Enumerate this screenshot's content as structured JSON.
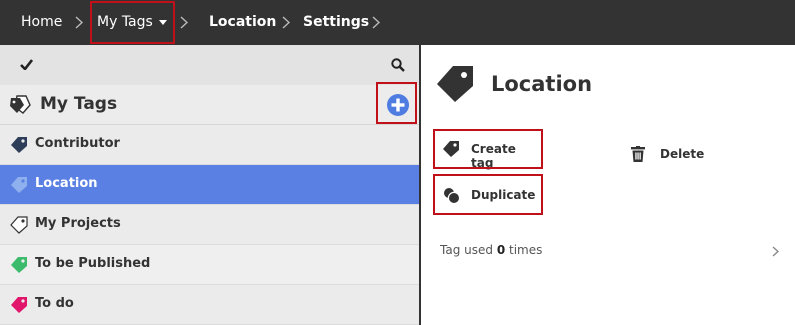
{
  "breadcrumb": {
    "items": [
      {
        "label": "Home"
      },
      {
        "label": "My Tags"
      },
      {
        "label": "Location"
      },
      {
        "label": "Settings"
      }
    ]
  },
  "sidebar": {
    "title": "My Tags",
    "tags": [
      {
        "label": "Contributor",
        "color": "#2e3e58"
      },
      {
        "label": "Location",
        "color": "#6f9ae6",
        "active": true
      },
      {
        "label": "My Projects",
        "color": "#ffffff"
      },
      {
        "label": "To be Published",
        "color": "#3dbb6c"
      },
      {
        "label": "To do",
        "color": "#e0156b"
      }
    ]
  },
  "detail": {
    "title": "Location",
    "actions": {
      "create_tag": "Create tag",
      "delete": "Delete",
      "duplicate": "Duplicate"
    },
    "usage": {
      "prefix": "Tag used",
      "count": "0",
      "suffix": "times"
    }
  },
  "colors": {
    "topbar": "#333333",
    "active_row": "#5b80e3",
    "add_button": "#4e7ce0",
    "highlight": "#c0101a"
  }
}
